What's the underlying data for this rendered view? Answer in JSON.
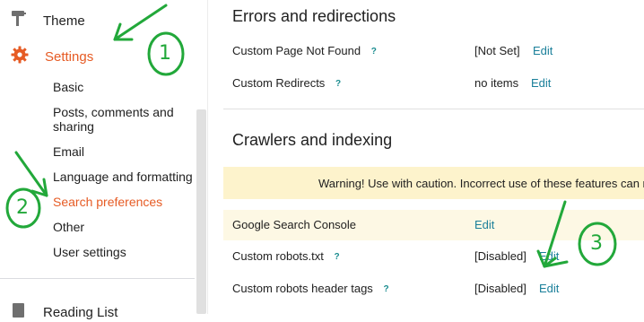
{
  "sidebar": {
    "theme": {
      "label": "Theme",
      "icon": "paint-roller-icon"
    },
    "settings": {
      "label": "Settings",
      "icon": "gear-icon",
      "color": "#e65b24"
    },
    "sub_items": [
      "Basic",
      "Posts, comments and sharing",
      "Email",
      "Language and formatting",
      "Search preferences",
      "Other",
      "User settings"
    ],
    "reading_list": {
      "label": "Reading List",
      "icon": "list-icon"
    }
  },
  "errors_section": {
    "title": "Errors and redirections",
    "rows": [
      {
        "label": "Custom Page Not Found",
        "help": "?",
        "value": "[Not Set]",
        "edit": "Edit"
      },
      {
        "label": "Custom Redirects",
        "help": "?",
        "value": "no items",
        "edit": "Edit"
      }
    ]
  },
  "crawlers_section": {
    "title": "Crawlers and indexing",
    "warning": "Warning! Use with caution. Incorrect use of these features can r",
    "rows": [
      {
        "label": "Google Search Console",
        "edit": "Edit"
      },
      {
        "label": "Custom robots.txt",
        "help": "?",
        "value": "[Disabled]",
        "edit": "Edit"
      },
      {
        "label": "Custom robots header tags",
        "help": "?",
        "value": "[Disabled]",
        "edit": "Edit"
      }
    ]
  },
  "annotations": {
    "one": "1",
    "two": "2",
    "three": "3",
    "color": "#22a83a"
  },
  "colors": {
    "accent": "#e65b24",
    "link": "#1a7f9a",
    "warning_bg": "#fdf3cc"
  }
}
